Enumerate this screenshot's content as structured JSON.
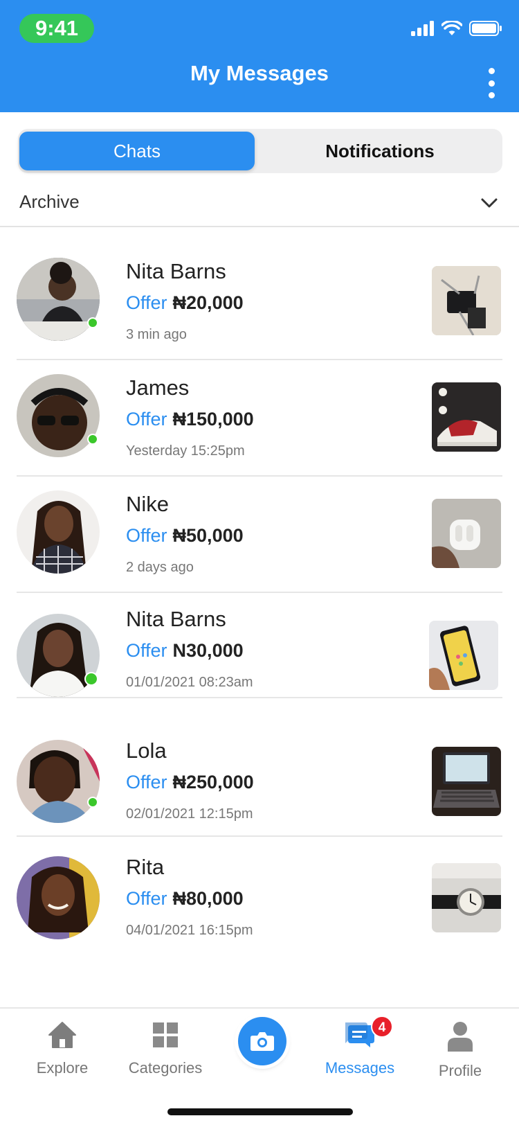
{
  "status_bar": {
    "time": "9:41"
  },
  "header": {
    "title": "My Messages"
  },
  "tabs": {
    "chats": "Chats",
    "notifications": "Notifications"
  },
  "archive": {
    "label": "Archive"
  },
  "offer_label": "Offer",
  "chats": [
    {
      "name": "Nita Barns",
      "amount": "₦20,000",
      "time": "3 min ago",
      "online": true
    },
    {
      "name": "James",
      "amount": "₦150,000",
      "time": "Yesterday 15:25pm",
      "online": true
    },
    {
      "name": "Nike",
      "amount": "₦50,000",
      "time": "2 days ago",
      "online": false
    },
    {
      "name": "Nita Barns",
      "amount": "N30,000",
      "time": "01/01/2021 08:23am",
      "online": true
    },
    {
      "name": "Lola",
      "amount": "₦250,000",
      "time": "02/01/2021 12:15pm",
      "online": true
    },
    {
      "name": "Rita",
      "amount": "₦80,000",
      "time": "04/01/2021 16:15pm",
      "online": false
    }
  ],
  "bottom_nav": {
    "explore": "Explore",
    "categories": "Categories",
    "messages": "Messages",
    "profile": "Profile",
    "messages_badge": "4"
  },
  "colors": {
    "accent": "#2b8ef0",
    "online": "#3bc72b",
    "badge": "#e8202a"
  }
}
